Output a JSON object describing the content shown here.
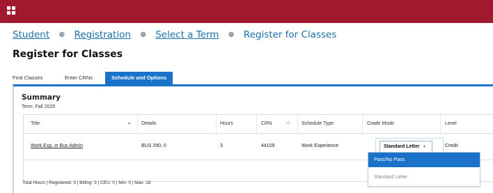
{
  "header": {
    "menu_icon": "app-grid-icon",
    "color": "#a0192e"
  },
  "breadcrumb": {
    "items": [
      "Student",
      "Registration",
      "Select a Term",
      "Register for Classes"
    ]
  },
  "page_title": "Register for Classes",
  "tabs": [
    {
      "label": "Find Classes",
      "active": false
    },
    {
      "label": "Enter CRNs",
      "active": false
    },
    {
      "label": "Schedule and Options",
      "active": true
    }
  ],
  "summary": {
    "title": "Summary",
    "term": "Term: Fall 2025"
  },
  "table": {
    "columns": [
      "Title",
      "Details",
      "Hours",
      "CRN",
      "Schedule Type",
      "Grade Mode",
      "Level"
    ],
    "rows": [
      {
        "title": "Work Exp. in Bus Admin",
        "details": "BUS 290, 0",
        "hours": "3",
        "crn": "44109",
        "schedule_type": "Work Experience",
        "grade_mode": "Standard Letter",
        "level": "Credit"
      }
    ]
  },
  "grade_mode_dropdown": {
    "options": [
      "Pass/No Pass",
      "Standard Letter"
    ],
    "highlighted": "Pass/No Pass"
  },
  "footer": "Total Hours | Registered: 3 | Billing: 3 | CEU: 0 | Min: 0 | Max: 18",
  "colors": {
    "accent": "#1a73c8",
    "link": "#1c6ea6",
    "brand": "#a0192e"
  }
}
